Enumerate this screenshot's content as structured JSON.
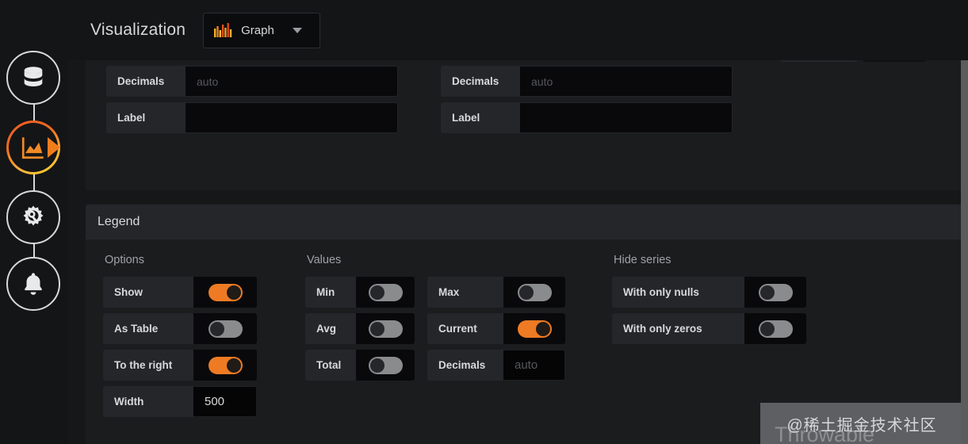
{
  "sidebar": {
    "items": [
      {
        "name": "queries",
        "icon": "database-icon",
        "active": false
      },
      {
        "name": "visualization",
        "icon": "graph-area-icon",
        "active": true
      },
      {
        "name": "general",
        "icon": "gear-wrench-icon",
        "active": false
      },
      {
        "name": "alert",
        "icon": "bell-icon",
        "active": false
      }
    ]
  },
  "header": {
    "title": "Visualization",
    "picker": {
      "label": "Graph",
      "icon": "bar-chart-icon",
      "caret": "chevron-down-icon"
    }
  },
  "axes": {
    "left": {
      "rows": [
        {
          "label": "Decimals",
          "value": "",
          "placeholder": "auto"
        },
        {
          "label": "Label",
          "value": "",
          "placeholder": ""
        }
      ]
    },
    "right": {
      "rows": [
        {
          "label": "Decimals",
          "value": "",
          "placeholder": "auto"
        },
        {
          "label": "Label",
          "value": "",
          "placeholder": ""
        }
      ]
    }
  },
  "legend": {
    "title": "Legend",
    "sections": [
      {
        "title": "Options",
        "columns": [
          {
            "rows": [
              {
                "label": "Show",
                "type": "toggle",
                "on": true
              },
              {
                "label": "As Table",
                "type": "toggle",
                "on": false
              },
              {
                "label": "To the right",
                "type": "toggle",
                "on": true
              },
              {
                "label": "Width",
                "type": "input",
                "value": "500",
                "placeholder": ""
              }
            ]
          }
        ]
      },
      {
        "title": "Values",
        "columns": [
          {
            "rows": [
              {
                "label": "Min",
                "type": "toggle",
                "on": false
              },
              {
                "label": "Avg",
                "type": "toggle",
                "on": false
              },
              {
                "label": "Total",
                "type": "toggle",
                "on": false
              }
            ]
          },
          {
            "rows": [
              {
                "label": "Max",
                "type": "toggle",
                "on": false
              },
              {
                "label": "Current",
                "type": "toggle",
                "on": true
              },
              {
                "label": "Decimals",
                "type": "input",
                "value": "",
                "placeholder": "auto"
              }
            ]
          }
        ]
      },
      {
        "title": "Hide series",
        "columns": [
          {
            "rows": [
              {
                "label": "With only nulls",
                "type": "toggle",
                "on": false
              },
              {
                "label": "With only zeros",
                "type": "toggle",
                "on": false
              }
            ]
          }
        ]
      }
    ]
  },
  "watermark": {
    "text": "@稀土掘金技术社区",
    "ghost": "Throwable"
  },
  "colors": {
    "accent": "#ee7b23",
    "page_bg": "#161719",
    "card_bg": "#1b1c1e",
    "label_bg": "#25262a",
    "input_bg": "#09090b",
    "text": "#d8d9da"
  }
}
